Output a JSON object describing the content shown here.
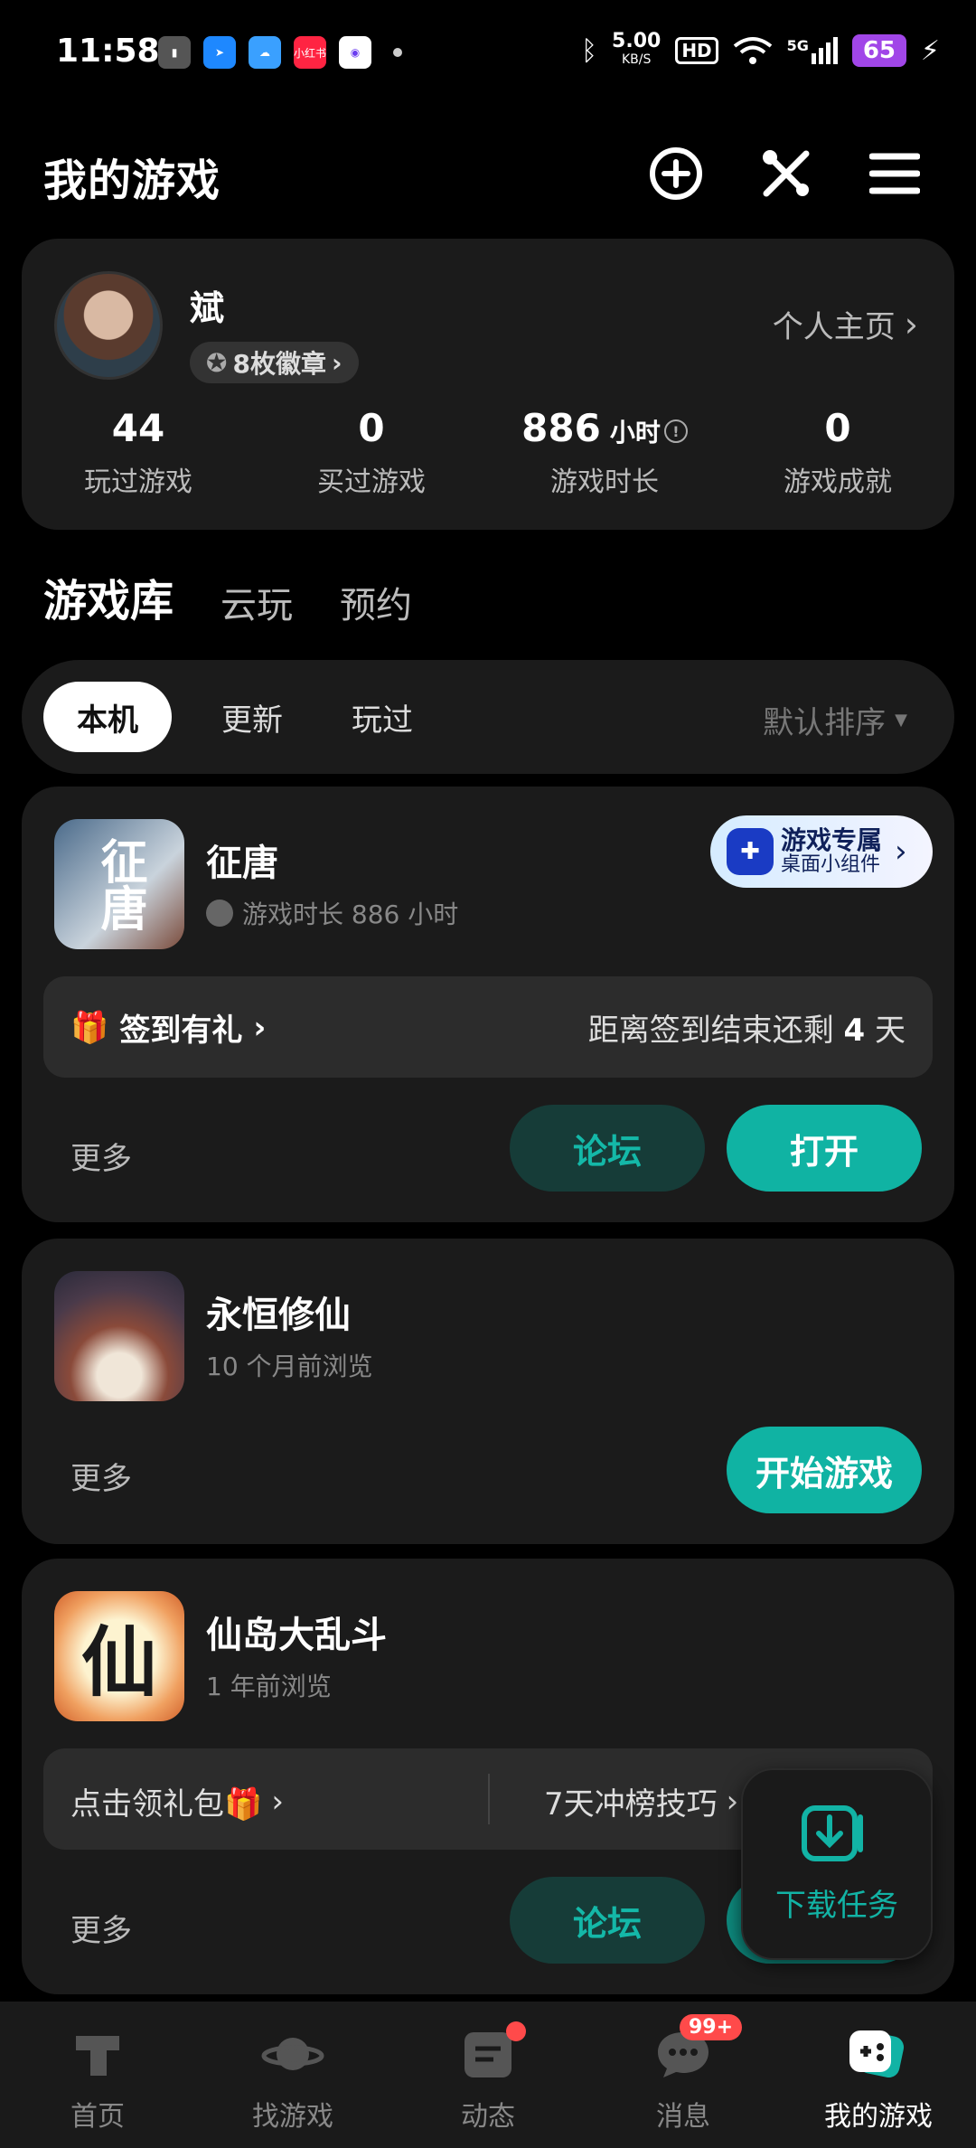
{
  "status_bar": {
    "time": "11:58",
    "net_speed": "5.00",
    "net_unit": "KB/S",
    "hd": "HD",
    "signal": "5G",
    "battery": "65",
    "apps": [
      "app-a",
      "app-b",
      "app-c",
      "小红书",
      "app-e"
    ]
  },
  "header": {
    "title": "我的游戏"
  },
  "profile": {
    "name": "斌",
    "badges": "8枚徽章",
    "home_link": "个人主页",
    "stats": [
      {
        "value": "44",
        "label": "玩过游戏"
      },
      {
        "value": "0",
        "label": "买过游戏"
      },
      {
        "value": "886",
        "unit": "小时",
        "label": "游戏时长"
      },
      {
        "value": "0",
        "label": "游戏成就"
      }
    ]
  },
  "tabs": [
    "游戏库",
    "云玩",
    "预约"
  ],
  "filters": {
    "chips": [
      "本机",
      "更新",
      "玩过"
    ],
    "sort": "默认排序"
  },
  "games": [
    {
      "name": "征唐",
      "subtitle": "游戏时长 886 小时",
      "widget_title": "游戏专属",
      "widget_sub": "桌面小组件",
      "strip_left": "签到有礼",
      "strip_right_pre": "距离签到结束还剩",
      "strip_right_num": "4",
      "strip_right_post": "天",
      "more": "更多",
      "forum": "论坛",
      "primary": "打开"
    },
    {
      "name": "永恒修仙",
      "subtitle": "10 个月前浏览",
      "more": "更多",
      "primary": "开始游戏"
    },
    {
      "name": "仙岛大乱斗",
      "subtitle": "1 年前浏览",
      "strip_left": "点击领礼包🎁",
      "strip_right": "7天冲榜技巧",
      "more": "更多",
      "forum": "论坛"
    }
  ],
  "download_task": "下载任务",
  "bottom_nav": [
    {
      "label": "首页"
    },
    {
      "label": "找游戏"
    },
    {
      "label": "动态"
    },
    {
      "label": "消息",
      "badge": "99+"
    },
    {
      "label": "我的游戏"
    }
  ],
  "colors": {
    "accent": "#10b3a3",
    "background": "#000000",
    "card": "#1b1b1b"
  }
}
